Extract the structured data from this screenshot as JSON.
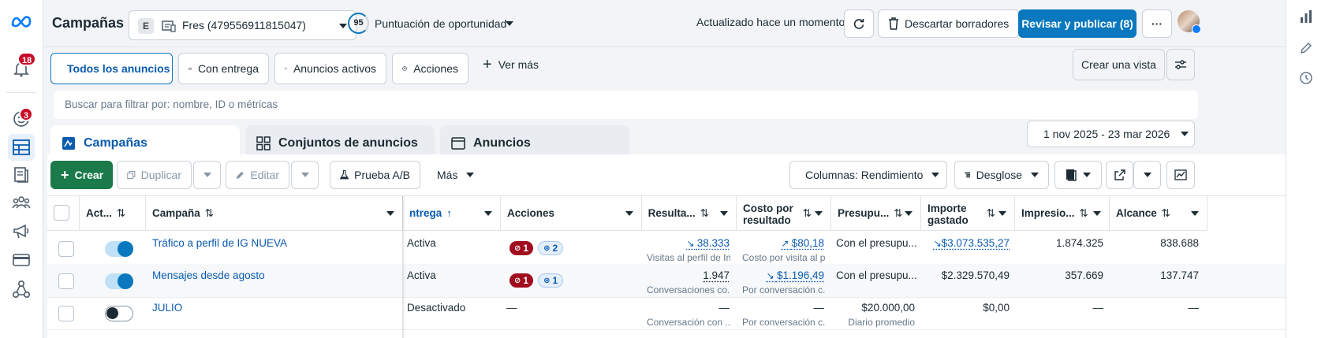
{
  "nav": {
    "notif_count": "18",
    "support_count": "3"
  },
  "header": {
    "title": "Campañas",
    "account_initial": "E",
    "account_name": "Fres (479556911815047)",
    "opportunity_score": "95",
    "opportunity_label": "Puntuación de oportunidad",
    "updated_text": "Actualizado hace un momento",
    "discard_label": "Descartar borradores",
    "publish_label": "Revisar y publicar (8)",
    "more_label": "···"
  },
  "filters": {
    "tabs": [
      "Todos los anuncios",
      "Con entrega",
      "Anuncios activos",
      "Acciones"
    ],
    "see_more": "Ver más",
    "create_view": "Crear una vista",
    "search_placeholder": "Buscar para filtrar por: nombre, ID o métricas"
  },
  "levels": {
    "campaigns": "Campañas",
    "adsets": "Conjuntos de anuncios",
    "ads": "Anuncios",
    "date_range": "1 nov 2025 - 23 mar 2026"
  },
  "toolbar": {
    "create": "Crear",
    "duplicate": "Duplicar",
    "edit": "Editar",
    "ab_test": "Prueba A/B",
    "more": "Más",
    "columns": "Columnas: Rendimiento",
    "breakdown": "Desglose"
  },
  "table": {
    "headers": {
      "active": "Act...",
      "campaign": "Campaña",
      "delivery": "ntrega",
      "actions": "Acciones",
      "results": "Resulta...",
      "cost_per_result_1": "Costo por",
      "cost_per_result_2": "resultado",
      "budget": "Presupu...",
      "spent_1": "Importe",
      "spent_2": "gastado",
      "impressions": "Impresio...",
      "reach": "Alcance"
    },
    "rows": [
      {
        "active": true,
        "name": "Tráfico a perfil de IG NUEVA",
        "delivery": "Activa",
        "errors": "1",
        "recs": "2",
        "results": "38.333",
        "results_sub": "Visitas al perfil de In...",
        "cost": "$80,18",
        "cost_sub": "Costo por visita al p...",
        "budget": "Con el presupu...",
        "budget_sub": "",
        "spent": "$3.073.535,27",
        "impressions": "1.874.325",
        "reach": "838.688"
      },
      {
        "active": true,
        "name": "Mensajes desde agosto",
        "delivery": "Activa",
        "errors": "1",
        "recs": "1",
        "results": "1.947",
        "results_sub": "Conversaciones co...",
        "cost": "$1.196,49",
        "cost_sub": "Por conversación c...",
        "budget": "Con el presupu...",
        "budget_sub": "",
        "spent": "$2.329.570,49",
        "impressions": "357.669",
        "reach": "137.747"
      },
      {
        "active": false,
        "name": "JULIO",
        "delivery": "Desactivado",
        "actions_text": "—",
        "results": "—",
        "results_sub": "Conversación con ...",
        "cost": "—",
        "cost_sub": "Por conversación c...",
        "budget": "$20.000,00",
        "budget_sub": "Diario promedio",
        "spent": "$0,00",
        "impressions": "—",
        "reach": "—"
      }
    ]
  },
  "colors": {
    "accent": "#0a78be",
    "create_green": "#1a7a4a",
    "error_red": "#a00d1e",
    "badge_red": "#c80a28"
  }
}
